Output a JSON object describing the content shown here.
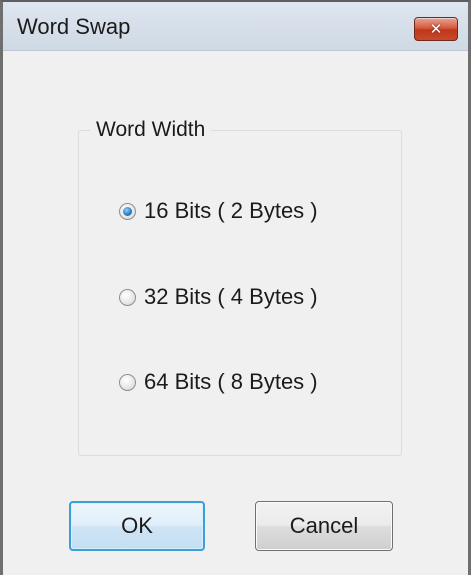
{
  "window": {
    "title": "Word Swap",
    "close_icon": "close-icon"
  },
  "group": {
    "label": "Word Width",
    "options": [
      {
        "label": "16 Bits ( 2 Bytes )",
        "checked": true
      },
      {
        "label": "32 Bits ( 4 Bytes )",
        "checked": false
      },
      {
        "label": "64 Bits ( 8 Bytes )",
        "checked": false
      }
    ]
  },
  "buttons": {
    "ok": "OK",
    "cancel": "Cancel"
  },
  "colors": {
    "close_button": "#c1371b",
    "default_button_border": "#3c9fd8",
    "radio_selected": "#2c7fc4"
  }
}
